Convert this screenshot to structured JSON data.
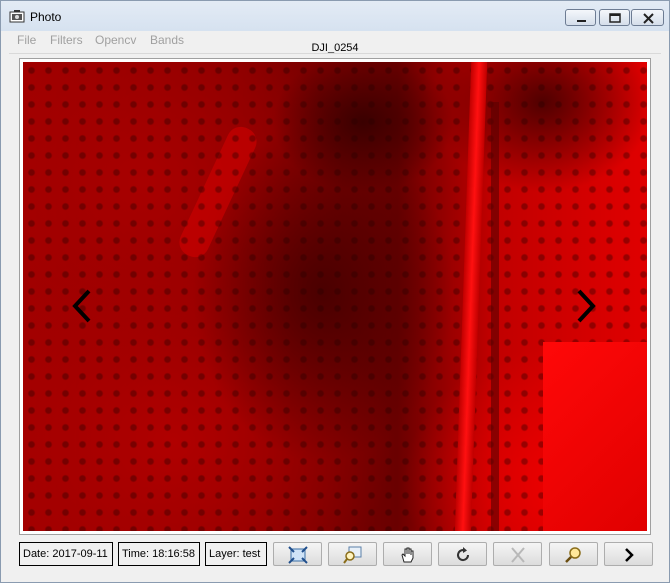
{
  "window": {
    "title": "Photo",
    "photo_name": "DJI_0254"
  },
  "menu": {
    "items": [
      "File",
      "Filters",
      "Opencv",
      "Bands"
    ]
  },
  "status": {
    "date": "Date: 2017-09-11",
    "time": "Time: 18:16:58",
    "layer": "Layer: test"
  },
  "toolbar": {
    "buttons": [
      {
        "icon": "fit-to-window-icon",
        "enabled": true
      },
      {
        "icon": "zoom-in-icon",
        "enabled": true
      },
      {
        "icon": "pan-hand-icon",
        "enabled": true
      },
      {
        "icon": "rotate-icon",
        "enabled": true
      },
      {
        "icon": "cancel-x-icon",
        "enabled": false
      },
      {
        "icon": "zoom-search-icon",
        "enabled": true
      },
      {
        "icon": "next-chevron-icon",
        "enabled": true
      }
    ]
  },
  "colors": {
    "image_tint": "#c00000",
    "menu_disabled": "#a0a0a0"
  }
}
